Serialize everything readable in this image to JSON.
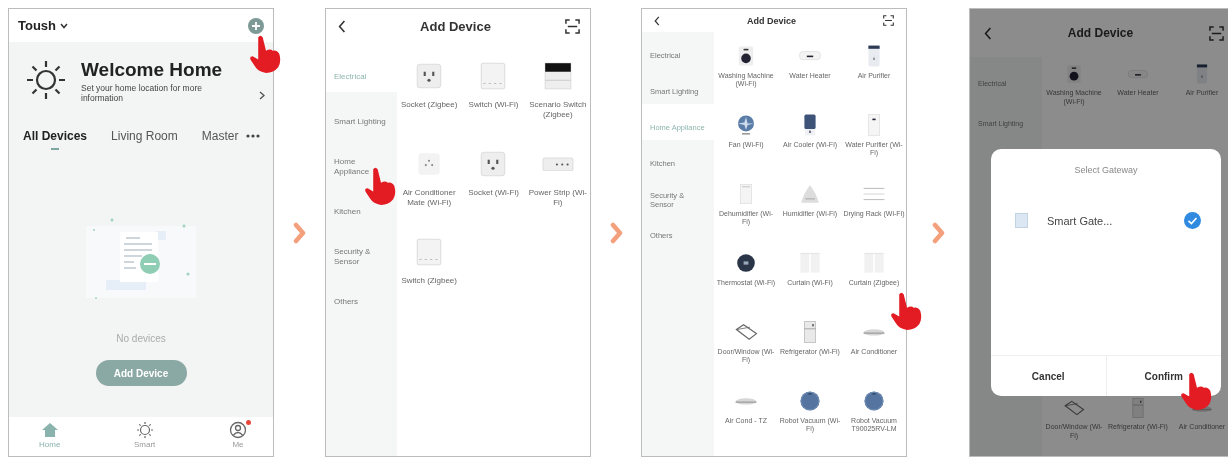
{
  "panels": [
    {
      "kind": "home",
      "home_name": "Toush",
      "welcome": {
        "title": "Welcome Home",
        "subtitle": "Set your home location for more information"
      },
      "rooms": [
        {
          "label": "All Devices",
          "selected": true
        },
        {
          "label": "Living Room",
          "selected": false
        },
        {
          "label": "Master",
          "selected": false
        }
      ],
      "empty_text": "No devices",
      "add_button": "Add Device",
      "nav": [
        {
          "label": "Home",
          "kind": "home",
          "selected": true,
          "notification": false
        },
        {
          "label": "Smart",
          "kind": "smart",
          "selected": false,
          "notification": false
        },
        {
          "label": "Me",
          "kind": "me",
          "selected": false,
          "notification": true
        }
      ]
    },
    {
      "kind": "catalog",
      "title": "Add Device",
      "categories": [
        {
          "label": "Electrical",
          "selected": true
        },
        {
          "label": "Smart Lighting",
          "selected": false
        },
        {
          "label": "Home Appliance",
          "selected": false
        },
        {
          "label": "Kitchen",
          "selected": false
        },
        {
          "label": "Security & Sensor",
          "selected": false
        },
        {
          "label": "Others",
          "selected": false
        }
      ],
      "devices": [
        {
          "label": "Socket (Zigbee)",
          "kind": "socket"
        },
        {
          "label": "Switch (Wi-Fi)",
          "kind": "switch"
        },
        {
          "label": "Scenario Switch (Zigbee)",
          "kind": "scene"
        },
        {
          "label": "Air Conditioner Mate (Wi-Fi)",
          "kind": "acmate"
        },
        {
          "label": "Socket (Wi-Fi)",
          "kind": "socket"
        },
        {
          "label": "Power Strip (Wi-Fi)",
          "kind": "strip"
        },
        {
          "label": "Switch (Zigbee)",
          "kind": "switch"
        }
      ]
    },
    {
      "kind": "catalog",
      "title": "Add Device",
      "categories": [
        {
          "label": "Electrical",
          "selected": false
        },
        {
          "label": "Smart Lighting",
          "selected": false
        },
        {
          "label": "Home Appliance",
          "selected": true
        },
        {
          "label": "Kitchen",
          "selected": false
        },
        {
          "label": "Security & Sensor",
          "selected": false
        },
        {
          "label": "Others",
          "selected": false
        }
      ],
      "devices": [
        {
          "label": "Washing Machine (Wi-Fi)",
          "kind": "washer"
        },
        {
          "label": "Water Heater",
          "kind": "heater"
        },
        {
          "label": "Air Purifier",
          "kind": "purifier"
        },
        {
          "label": "Fan (Wi-Fi)",
          "kind": "fan"
        },
        {
          "label": "Air Cooler (Wi-Fi)",
          "kind": "cooler"
        },
        {
          "label": "Water Purifier (Wi-Fi)",
          "kind": "tower"
        },
        {
          "label": "Dehumidifier (Wi-Fi)",
          "kind": "dehumid"
        },
        {
          "label": "Humidifier (Wi-Fi)",
          "kind": "humidifier"
        },
        {
          "label": "Drying Rack (Wi-Fi)",
          "kind": "rack"
        },
        {
          "label": "Thermostat (Wi-Fi)",
          "kind": "thermostat"
        },
        {
          "label": "Curtain (Wi-Fi)",
          "kind": "curtain"
        },
        {
          "label": "Curtain (Zigbee)",
          "kind": "curtain"
        },
        {
          "label": "Door/Window (Wi-Fi)",
          "kind": "door"
        },
        {
          "label": "Refrigerator (Wi-Fi)",
          "kind": "fridge"
        },
        {
          "label": "Air Conditioner",
          "kind": "ac"
        },
        {
          "label": "Air Cond - TZ",
          "kind": "ac"
        },
        {
          "label": "Robot Vacuum (Wi-Fi)",
          "kind": "vacuum"
        },
        {
          "label": "Robot Vacuum T90025RV-LM",
          "kind": "vacuum"
        }
      ]
    },
    {
      "kind": "gateway",
      "title": "Add Device",
      "categories": [
        {
          "label": "Electrical",
          "selected": false
        },
        {
          "label": "Smart Lighting",
          "selected": false
        }
      ],
      "device_rows": [
        [
          {
            "label": "Washing Machine (Wi-Fi)",
            "kind": "washer"
          },
          {
            "label": "Water Heater",
            "kind": "heater"
          },
          {
            "label": "Air Purifier",
            "kind": "purifier"
          }
        ],
        [
          {
            "label": "Door/Window (Wi-Fi)",
            "kind": "door"
          },
          {
            "label": "Refrigerator (Wi-Fi)",
            "kind": "fridge"
          },
          {
            "label": "Air Conditioner",
            "kind": "ac"
          }
        ]
      ],
      "dialog": {
        "title": "Select Gateway",
        "gateways": [
          {
            "name": "Smart Gate...",
            "checked": true
          }
        ],
        "buttons": [
          "Cancel",
          "Confirm"
        ]
      }
    }
  ]
}
